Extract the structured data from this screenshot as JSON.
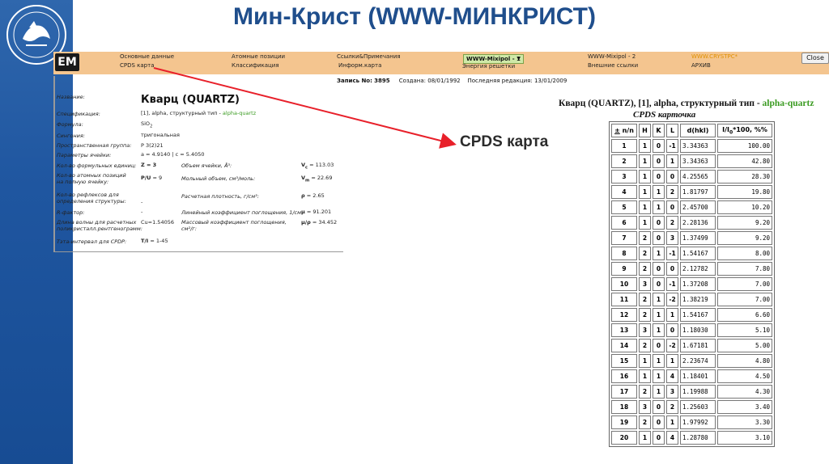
{
  "slide": {
    "title": "Мин-Крист (WWW-МИНКРИСТ)"
  },
  "menu": {
    "col1": [
      "Основные данные",
      "CPDS карта"
    ],
    "col2": [
      "Атомные позиции",
      "Классификация"
    ],
    "col3": [
      "Ссылки&Примечания",
      "Информ.карта"
    ],
    "col4_select": "WWW-Mixipol - 1",
    "col4_below": "Энергия решетки",
    "col5": [
      "WWW-Mixipol - 2",
      "Внешние ссылки"
    ],
    "col6": [
      "WWW.CRYSTPC*",
      "АРХИВ"
    ],
    "close": "Close"
  },
  "record": {
    "label": "Запись No:",
    "number": "3895",
    "created": "Создана: 08/01/1992",
    "edited": "Последняя редакция: 13/01/2009"
  },
  "mineral": {
    "name_label": "Название:",
    "name": "Кварц (QUARTZ)",
    "spec_label": "Спецификация:",
    "spec_prefix": "[1], alpha, структурный тип - ",
    "spec_type": "alpha-quartz",
    "formula_label": "Формула:",
    "formula_main": "SiO",
    "formula_sub": "2",
    "syngony_label": "Сингония:",
    "syngony": "тригональная",
    "space_group_label": "Пространственная группа:",
    "space_group": "P 3(2)21",
    "cell_label": "Параметры ячейки:",
    "cell": "a = 4.9140 | c = 5.4050",
    "z_label": "Кол-во формульных единиц:",
    "z_val": "Z = 3",
    "vol_label": "Объем ячейки, Å³:",
    "vol_sym": "V",
    "vol_sub": "c",
    "vol_val": "= 113.03",
    "atoms_label_1": "Кол-во атомных позиций",
    "atoms_label_2": "на полную ячейку:",
    "atoms_sym": "P/U",
    "atoms_val": "= 9",
    "molvol_label": "Мольный объем, см³/моль:",
    "molvol_sym": "V",
    "molvol_sub": "m",
    "molvol_val": "= 22.69",
    "refl_label_1": "Кол-во рефлексов для",
    "refl_label_2": "определения структуры:",
    "refl_val": "-",
    "density_label": "Расчетная плотность, г/см³:",
    "density_sym": "ρ",
    "density_val": "= 2.65",
    "r_label": "R-фактор:",
    "r_val": "-",
    "linabs_label": "Линейный коэффициент поглощения, 1/см:",
    "linabs_sym": "μ",
    "linabs_val": "= 91.201",
    "wave_label_1": "Длина волны для расчетных",
    "wave_label_2": "поликристалл.рентгенограмм:",
    "wave_val": "Cu=1.54056",
    "massabs_label_1": "Массовый коэффициент поглощения,",
    "massabs_label_2": "см²/г:",
    "massabs_sym": "μ/ρ",
    "massabs_val": "= 34.452",
    "theta_label": "Тэта-интервал для CPDP:",
    "theta_sym": "T/I",
    "theta_val": "= 1-45"
  },
  "annotation": {
    "text": "CPDS карта",
    "arrow_color": "#e8202a"
  },
  "cpds": {
    "title_prefix": "Кварц (QUARTZ), [1], alpha, структурный тип - ",
    "title_type": "alpha-quartz",
    "subtitle": "CPDS карточка",
    "headers": {
      "n": "n/n",
      "n_mark": "±",
      "h": "H",
      "k": "K",
      "l": "L",
      "d": "d(hkl)",
      "i": "I/I",
      "i_sub": "0",
      "i_tail": "*100, %%"
    },
    "rows": [
      [
        "1",
        "1",
        "0",
        "-1",
        "3.34363",
        "100.00"
      ],
      [
        "2",
        "1",
        "0",
        "1",
        "3.34363",
        "42.80"
      ],
      [
        "3",
        "1",
        "0",
        "0",
        "4.25565",
        "28.30"
      ],
      [
        "4",
        "1",
        "1",
        "2",
        "1.81797",
        "19.80"
      ],
      [
        "5",
        "1",
        "1",
        "0",
        "2.45700",
        "10.20"
      ],
      [
        "6",
        "1",
        "0",
        "2",
        "2.28136",
        "9.20"
      ],
      [
        "7",
        "2",
        "0",
        "3",
        "1.37499",
        "9.20"
      ],
      [
        "8",
        "2",
        "1",
        "-1",
        "1.54167",
        "8.00"
      ],
      [
        "9",
        "2",
        "0",
        "0",
        "2.12782",
        "7.80"
      ],
      [
        "10",
        "3",
        "0",
        "-1",
        "1.37208",
        "7.00"
      ],
      [
        "11",
        "2",
        "1",
        "-2",
        "1.38219",
        "7.00"
      ],
      [
        "12",
        "2",
        "1",
        "1",
        "1.54167",
        "6.60"
      ],
      [
        "13",
        "3",
        "1",
        "0",
        "1.18030",
        "5.10"
      ],
      [
        "14",
        "2",
        "0",
        "-2",
        "1.67181",
        "5.00"
      ],
      [
        "15",
        "1",
        "1",
        "1",
        "2.23674",
        "4.80"
      ],
      [
        "16",
        "1",
        "1",
        "4",
        "1.18401",
        "4.50"
      ],
      [
        "17",
        "2",
        "1",
        "3",
        "1.19988",
        "4.30"
      ],
      [
        "18",
        "3",
        "0",
        "2",
        "1.25603",
        "3.40"
      ],
      [
        "19",
        "2",
        "0",
        "1",
        "1.97992",
        "3.30"
      ],
      [
        "20",
        "1",
        "0",
        "4",
        "1.28780",
        "3.10"
      ]
    ]
  }
}
